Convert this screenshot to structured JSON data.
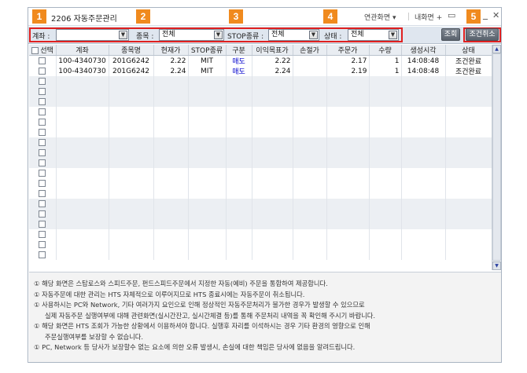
{
  "window": {
    "title": "2206 자동주문관리",
    "links": [
      "연관화면 ▾",
      "내화면 +"
    ],
    "icons": [
      "screen-icon",
      "minimize-icon",
      "close-icon"
    ]
  },
  "badges": [
    "1",
    "2",
    "3",
    "4",
    "5"
  ],
  "filters": {
    "account_label": "계좌 :",
    "account_value": "",
    "item_label": "종목 :",
    "item_value": "전체",
    "stop_label": "STOP종류 :",
    "stop_value": "전체",
    "status_label": "상태 :",
    "status_value": "전체"
  },
  "buttons": {
    "query": "조회",
    "cancel_condition": "조건취소"
  },
  "table": {
    "headers": [
      "선택",
      "계좌",
      "종목명",
      "현재가",
      "STOP종류",
      "구분",
      "이익목표가",
      "손절가",
      "주문가",
      "수량",
      "생성시각",
      "상태"
    ],
    "rows": [
      [
        "",
        "100-4340730",
        "201G6242",
        "2.22",
        "MIT",
        "매도",
        "2.22",
        "",
        "2.17",
        "1",
        "14:08:48",
        "조건완료"
      ],
      [
        "",
        "100-4340730",
        "201G6242",
        "2.24",
        "MIT",
        "매도",
        "2.24",
        "",
        "2.19",
        "1",
        "14:08:48",
        "조건완료"
      ]
    ]
  },
  "accent_colors": {
    "badge": "#f08a1e",
    "highlight_box": "#e02020",
    "sell_text": "#0000cc"
  },
  "notes": [
    "① 해당 화면은 스탑로스와 스피드주문, 펀드스피드주문에서 지정한 자동(예비) 주문을 통합하여 제공합니다.",
    "① 자동주문에 대한 관리는 HTS 자체적으로 이루어지므로 HTS 종료시에는 자동주문이 취소됩니다.",
    "① 사용하시는 PC와 Network, 기타 여러가지 요인으로 인해 정상적인 자동주문처리가 불가한 경우가 발생할 수 있으므로",
    "실제 자동주문 실행여부에 대해 관련화면(실시간잔고, 실시간체결 등)를 통해 주문처리 내역을 꼭 확인해 주시기 바랍니다.",
    "① 해당 화면은 HTS 조회가 가능한 상황에서 이용하셔야 합니다. 실행후 자리를 이석하시는 경우 기타 환경의 영향으로 인해",
    "주문실행여부를 보장할 수 없습니다.",
    "① PC, Network 등 당사가 보장할수 없는 요소에 의한 오류 발생시, 손실에 대한 책임은 당사에 없음을 알려드립니다."
  ]
}
